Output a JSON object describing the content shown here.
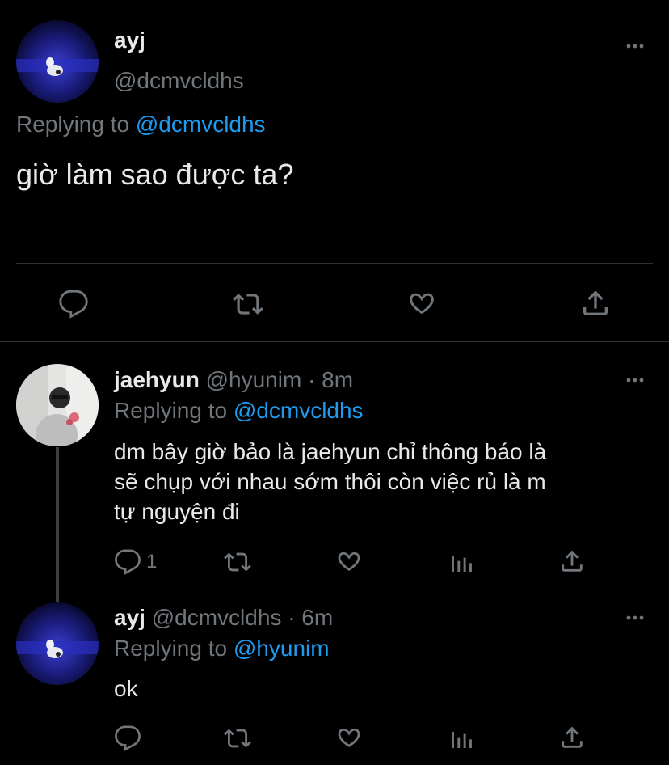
{
  "main_tweet": {
    "display_name": "ayj",
    "handle": "@dcmvcldhs",
    "replying_label": "Replying to",
    "replying_to": "@dcmvcldhs",
    "text": "giờ làm sao được ta?"
  },
  "replies": [
    {
      "display_name": "jaehyun",
      "handle": "@hyunim",
      "time": "· 8m",
      "replying_label": "Replying to",
      "replying_to": "@dcmvcldhs",
      "text_lines": [
        "dm bây giờ bảo là jaehyun chỉ thông báo là",
        "sẽ chụp với nhau sớm thôi còn việc rủ là m",
        "tự nguyện đi"
      ],
      "reply_count": "1"
    },
    {
      "display_name": "ayj",
      "handle": "@dcmvcldhs",
      "time": "· 6m",
      "replying_label": "Replying to",
      "replying_to": "@hyunim",
      "text": "ok"
    }
  ],
  "icons": {
    "more": "more-horizontal-icon",
    "reply": "reply-bubble-icon",
    "retweet": "retweet-icon",
    "like": "heart-icon",
    "share": "share-icon",
    "analytics": "analytics-icon"
  },
  "colors": {
    "background": "#000000",
    "text": "#e7e9ea",
    "muted": "#71767b",
    "link": "#1d9bf0",
    "divider": "#2f3336"
  }
}
